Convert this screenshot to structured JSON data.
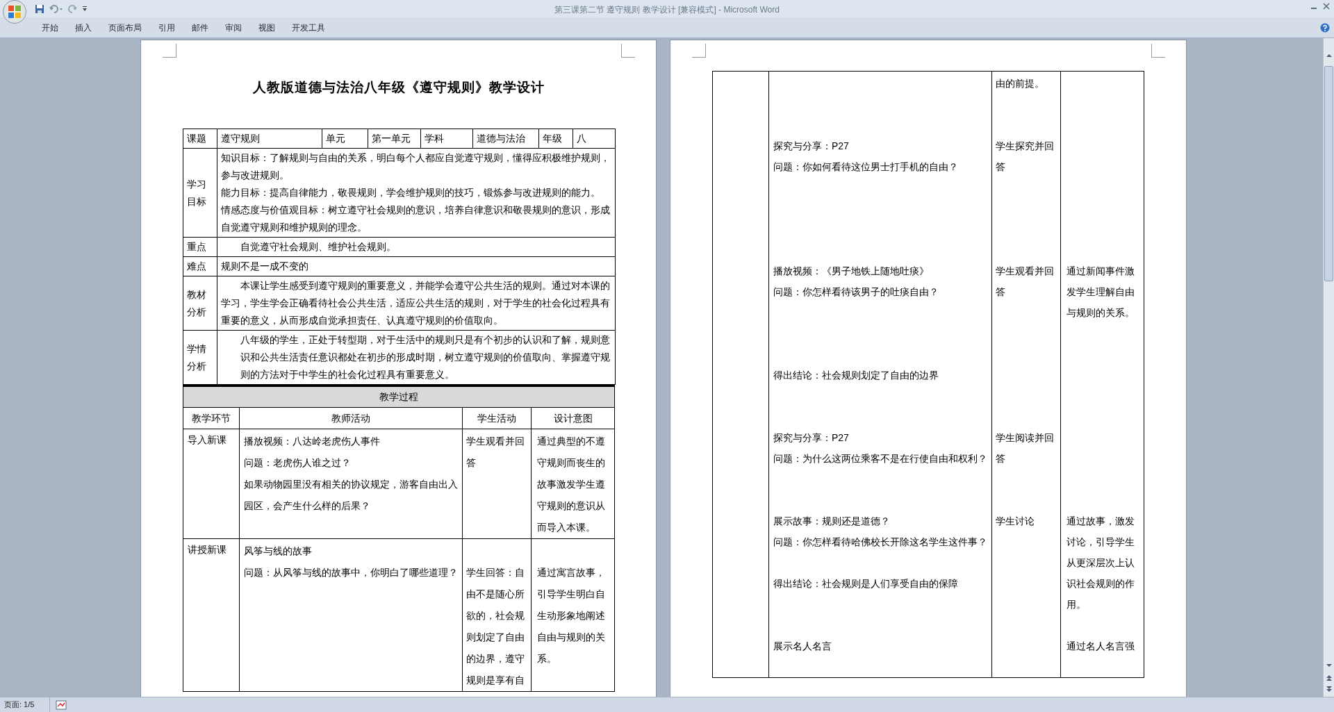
{
  "window": {
    "title": "第三课第二节  遵守规则  教学设计 [兼容模式] - Microsoft Word"
  },
  "ribbon_tabs": [
    "开始",
    "插入",
    "页面布局",
    "引用",
    "邮件",
    "审阅",
    "视图",
    "开发工具"
  ],
  "pages": [
    {
      "title": "人教版道德与法治八年级《遵守规则》教学设计",
      "info_row": [
        "课题",
        "遵守规则",
        "单元",
        "第一单元",
        "学科",
        "道德与法治",
        "年级",
        "八"
      ],
      "sections": [
        {
          "label": "学习目标",
          "paragraphs": [
            {
              "text": "知识目标：了解规则与自由的关系，明白每个人都应自觉遵守规则，懂得应积极维护规则，参与改进规则。"
            },
            {
              "text": "能力目标：提高自律能力，敬畏规则，学会维护规则的技巧，锻炼参与改进规则的能力。"
            },
            {
              "text": "情感态度与价值观目标：树立遵守社会规则的意识，培养自律意识和敬畏规则的意识，形成自觉遵守规则和维护规则的理念。"
            }
          ]
        },
        {
          "label": "重点",
          "paragraphs": [
            {
              "text": "自觉遵守社会规则、维护社会规则。",
              "block_indent": true
            }
          ]
        },
        {
          "label": "难点",
          "paragraphs": [
            {
              "text": "规则不是一成不变的"
            }
          ]
        },
        {
          "label": "教材分析",
          "paragraphs": [
            {
              "text": "本课让学生感受到遵守规则的重要意义，并能学会遵守公共生活的规则。通过对本课的学习，学生学会正确看待社会公共生活，适应公共生活的规则，对于学生的社会化过程具有重要的意义，从而形成自觉承担责任、认真遵守规则的价值取向。",
              "first_line_indent": true
            }
          ]
        },
        {
          "label": "学情分析",
          "paragraphs": [
            {
              "text": "八年级的学生，正处于转型期，对于生活中的规则只是有个初步的认识和了解，规则意识和公共生活责任意识都处在初步的形成时期，树立遵守规则的价值取向、掌握遵守规则的方法对于中学生的社会化过程具有重要意义。",
              "block_indent": true
            }
          ]
        }
      ],
      "process": {
        "header": "教学过程",
        "columns": [
          "教学环节",
          "教师活动",
          "学生活动",
          "设计意图"
        ],
        "rows": [
          {
            "stage": "导入新课",
            "teacher": [
              {
                "kind": "text",
                "text": "播放视频：八达岭老虎伤人事件"
              },
              {
                "kind": "text",
                "text": "问题：老虎伤人谁之过？"
              },
              {
                "kind": "text",
                "text": "如果动物园里没有相关的协议规定，游客自由出入园区，会产生什么样的后果？"
              }
            ],
            "student": [
              {
                "kind": "text",
                "text": "学生观看并回答"
              }
            ],
            "intent": [
              {
                "kind": "text",
                "text": "通过典型的不遵守规则而丧生的故事激发学生遵守规则的意识从而导入本课。"
              }
            ]
          },
          {
            "stage": "讲授新课",
            "teacher": [
              {
                "kind": "text",
                "text": "风筝与线的故事"
              },
              {
                "kind": "text",
                "text": "问题：从风筝与线的故事中，你明白了哪些道理？"
              },
              {
                "kind": "blank"
              },
              {
                "kind": "blank"
              },
              {
                "kind": "blank"
              },
              {
                "kind": "blank"
              },
              {
                "kind": "blank"
              }
            ],
            "student": [
              {
                "kind": "blank"
              },
              {
                "kind": "text",
                "text": "学生回答：自由不是随心所欲的，社会规则划定了自由的边界，遵守规则是享有自"
              }
            ],
            "intent": [
              {
                "kind": "blank"
              },
              {
                "kind": "text",
                "text": "通过寓言故事，引导学生明白自生动形象地阐述自由与规则的关系。"
              },
              {
                "kind": "blank"
              }
            ]
          }
        ]
      }
    },
    {
      "process": {
        "rows": [
          {
            "teacher": [
              {
                "kind": "blank"
              },
              {
                "kind": "blank"
              },
              {
                "kind": "blank"
              },
              {
                "kind": "text",
                "text": "探究与分享：P27"
              },
              {
                "kind": "text",
                "text": "问题：你如何看待这位男士打手机的自由？"
              },
              {
                "kind": "blank"
              },
              {
                "kind": "blank"
              },
              {
                "kind": "blank"
              },
              {
                "kind": "blank"
              },
              {
                "kind": "text",
                "text": "播放视频：《男子地铁上随地吐痰》"
              },
              {
                "kind": "text",
                "text": "问题：你怎样看待该男子的吐痰自由？"
              },
              {
                "kind": "blank"
              },
              {
                "kind": "blank"
              },
              {
                "kind": "blank"
              },
              {
                "kind": "text",
                "text": "得出结论：社会规则划定了自由的边界"
              },
              {
                "kind": "blank"
              },
              {
                "kind": "blank"
              },
              {
                "kind": "text",
                "text": "探究与分享：P27"
              },
              {
                "kind": "text",
                "text": "问题：为什么这两位乘客不是在行使自由和权利？"
              },
              {
                "kind": "blank"
              },
              {
                "kind": "blank"
              },
              {
                "kind": "text",
                "text": "展示故事：规则还是道德？"
              },
              {
                "kind": "text",
                "text": "问题：你怎样看待哈佛校长开除这名学生这件事？"
              },
              {
                "kind": "blank"
              },
              {
                "kind": "text",
                "text": "得出结论：社会规则是人们享受自由的保障"
              },
              {
                "kind": "blank"
              },
              {
                "kind": "blank"
              },
              {
                "kind": "text",
                "text": "展示名人名言"
              },
              {
                "kind": "blank"
              }
            ],
            "student": [
              {
                "kind": "text",
                "text": "由的前提。"
              },
              {
                "kind": "blank"
              },
              {
                "kind": "blank"
              },
              {
                "kind": "text",
                "text": "学生探究并回答"
              },
              {
                "kind": "blank"
              },
              {
                "kind": "blank"
              },
              {
                "kind": "blank"
              },
              {
                "kind": "blank"
              },
              {
                "kind": "text",
                "text": "学生观看并回答"
              },
              {
                "kind": "blank"
              },
              {
                "kind": "blank"
              },
              {
                "kind": "blank"
              },
              {
                "kind": "blank"
              },
              {
                "kind": "blank"
              },
              {
                "kind": "blank"
              },
              {
                "kind": "text",
                "text": "学生阅读并回答"
              },
              {
                "kind": "blank"
              },
              {
                "kind": "blank"
              },
              {
                "kind": "text",
                "text": "学生讨论"
              },
              {
                "kind": "blank"
              },
              {
                "kind": "blank"
              },
              {
                "kind": "blank"
              },
              {
                "kind": "blank"
              },
              {
                "kind": "blank"
              },
              {
                "kind": "blank"
              }
            ],
            "intent": [
              {
                "kind": "blank"
              },
              {
                "kind": "blank"
              },
              {
                "kind": "blank"
              },
              {
                "kind": "blank"
              },
              {
                "kind": "blank"
              },
              {
                "kind": "blank"
              },
              {
                "kind": "blank"
              },
              {
                "kind": "blank"
              },
              {
                "kind": "blank"
              },
              {
                "kind": "text",
                "text": "通过新闻事件激发学生理解自由与规则的关系。"
              },
              {
                "kind": "blank"
              },
              {
                "kind": "blank"
              },
              {
                "kind": "blank"
              },
              {
                "kind": "blank"
              },
              {
                "kind": "blank"
              },
              {
                "kind": "blank"
              },
              {
                "kind": "blank"
              },
              {
                "kind": "blank"
              },
              {
                "kind": "blank"
              },
              {
                "kind": "text",
                "text": "通过故事，激发讨论，引导学生从更深层次上认识社会规则的作用。"
              },
              {
                "kind": "blank"
              },
              {
                "kind": "text",
                "text": "通过名人名言强"
              }
            ]
          }
        ]
      }
    }
  ],
  "status_bar": {
    "page": "页面: 1/5"
  }
}
